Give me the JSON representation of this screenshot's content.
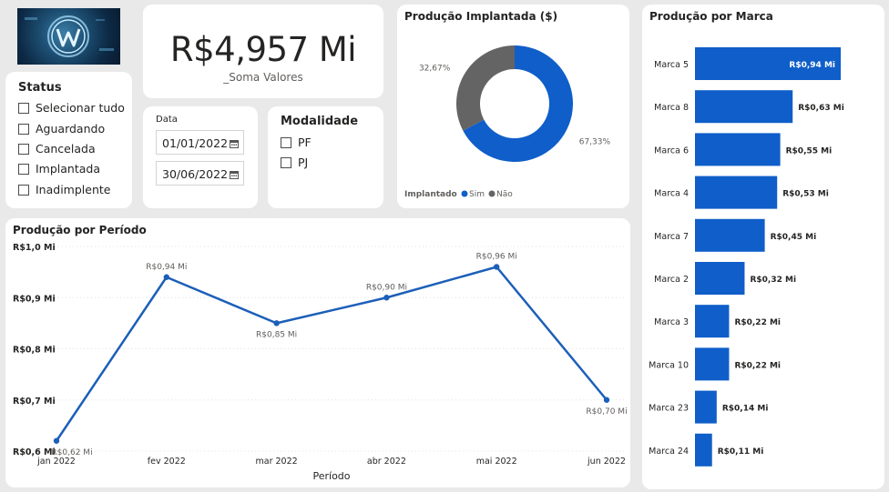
{
  "kpi": {
    "value": "R$4,957 Mi",
    "label": "_Soma Valores"
  },
  "status_slicer": {
    "title": "Status",
    "items": [
      "Selecionar tudo",
      "Aguardando",
      "Cancelada",
      "Implantada",
      "Inadimplente"
    ]
  },
  "date_slicer": {
    "label": "Data",
    "start": "01/01/2022",
    "end": "30/06/2022"
  },
  "modalidade_slicer": {
    "title": "Modalidade",
    "items": [
      "PF",
      "PJ"
    ]
  },
  "donut": {
    "title": "Produção Implantada ($)",
    "legend_title": "Implantado",
    "legend_items": [
      "Sim",
      "Não"
    ]
  },
  "line": {
    "title": "Produção por Período",
    "xlabel": "Período"
  },
  "bar": {
    "title": "Produção por Marca"
  },
  "colors": {
    "accent": "#0f5ec9",
    "gray": "#646464",
    "line": "#1c5fb8"
  },
  "chart_data": [
    {
      "type": "pie",
      "title": "Produção Implantada ($)",
      "legend_title": "Implantado",
      "categories": [
        "Sim",
        "Não"
      ],
      "values": [
        67.33,
        32.67
      ],
      "labels": [
        "67,33%",
        "32,67%"
      ]
    },
    {
      "type": "line",
      "title": "Produção por Período",
      "xlabel": "Período",
      "ylabel": "",
      "categories": [
        "jan 2022",
        "fev 2022",
        "mar 2022",
        "abr 2022",
        "mai 2022",
        "jun 2022"
      ],
      "values": [
        0.62,
        0.94,
        0.85,
        0.9,
        0.96,
        0.7
      ],
      "labels": [
        "R$0,62 Mi",
        "R$0,94 Mi",
        "R$0,85 Mi",
        "R$0,90 Mi",
        "R$0,96 Mi",
        "R$0,70 Mi"
      ],
      "ylim": [
        0.6,
        1.0
      ],
      "yticks": [
        0.6,
        0.7,
        0.8,
        0.9,
        1.0
      ],
      "ytick_labels": [
        "R$0,6 Mi",
        "R$0,7 Mi",
        "R$0,8 Mi",
        "R$0,9 Mi",
        "R$1,0 Mi"
      ]
    },
    {
      "type": "bar",
      "title": "Produção por Marca",
      "orientation": "horizontal",
      "categories": [
        "Marca 5",
        "Marca 8",
        "Marca 6",
        "Marca 4",
        "Marca 7",
        "Marca 2",
        "Marca 3",
        "Marca 10",
        "Marca 23",
        "Marca 24"
      ],
      "values": [
        0.94,
        0.63,
        0.55,
        0.53,
        0.45,
        0.32,
        0.22,
        0.22,
        0.14,
        0.11
      ],
      "labels": [
        "R$0,94 Mi",
        "R$0,63 Mi",
        "R$0,55 Mi",
        "R$0,53 Mi",
        "R$0,45 Mi",
        "R$0,32 Mi",
        "R$0,22 Mi",
        "R$0,22 Mi",
        "R$0,14 Mi",
        "R$0,11 Mi"
      ]
    }
  ]
}
